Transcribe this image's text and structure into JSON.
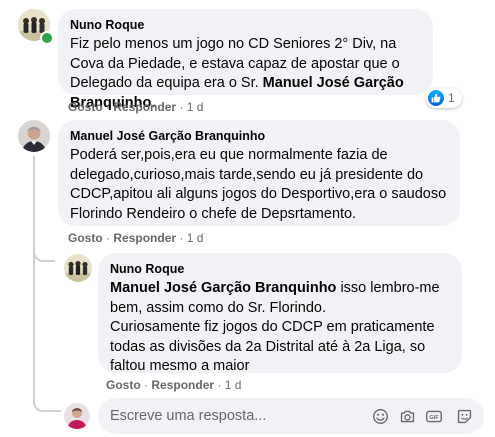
{
  "comments": [
    {
      "author": "Nuno Roque",
      "text_parts": [
        "Fiz pelo menos um jogo no CD Seniores 2° Div, na Cova da Piedade, e estava capaz de apostar que o Delegado da equipa era o Sr. ",
        "Manuel José Garção Branquinho",
        "."
      ],
      "like_label": "Gosto",
      "reply_label": "Responder",
      "time": "1 d",
      "reaction_count": "1"
    },
    {
      "author": "Manuel José Garção Branquinho",
      "text": "Poderá ser,pois,era eu que normalmente fazia de delegado,curioso,mais tarde,sendo eu já presidente do CDCP,apitou ali alguns jogos do Desportivo,era o saudoso Florindo Rendeiro o chefe de Depsrtamento.",
      "like_label": "Gosto",
      "reply_label": "Responder",
      "time": "1 d"
    }
  ],
  "reply": {
    "author": "Nuno Roque",
    "mention": "Manuel José Garção Branquinho",
    "text_after_mention": " isso lembro-me bem, assim como do Sr. Florindo.",
    "text_second": "Curiosamente fiz jogos do CDCP em praticamente todas as divisões da 2a Distrital até à 2a Liga, so faltou mesmo a maior",
    "like_label": "Gosto",
    "reply_label": "Responder",
    "time": "1 d"
  },
  "composer": {
    "placeholder": "Escreve uma resposta...",
    "tools": [
      "emoji-icon",
      "camera-icon",
      "gif-icon",
      "sticker-icon"
    ]
  },
  "colors": {
    "bubble": "#f0f2f5",
    "meta": "#65676b",
    "online": "#31a24c",
    "like": "#0866ff"
  }
}
